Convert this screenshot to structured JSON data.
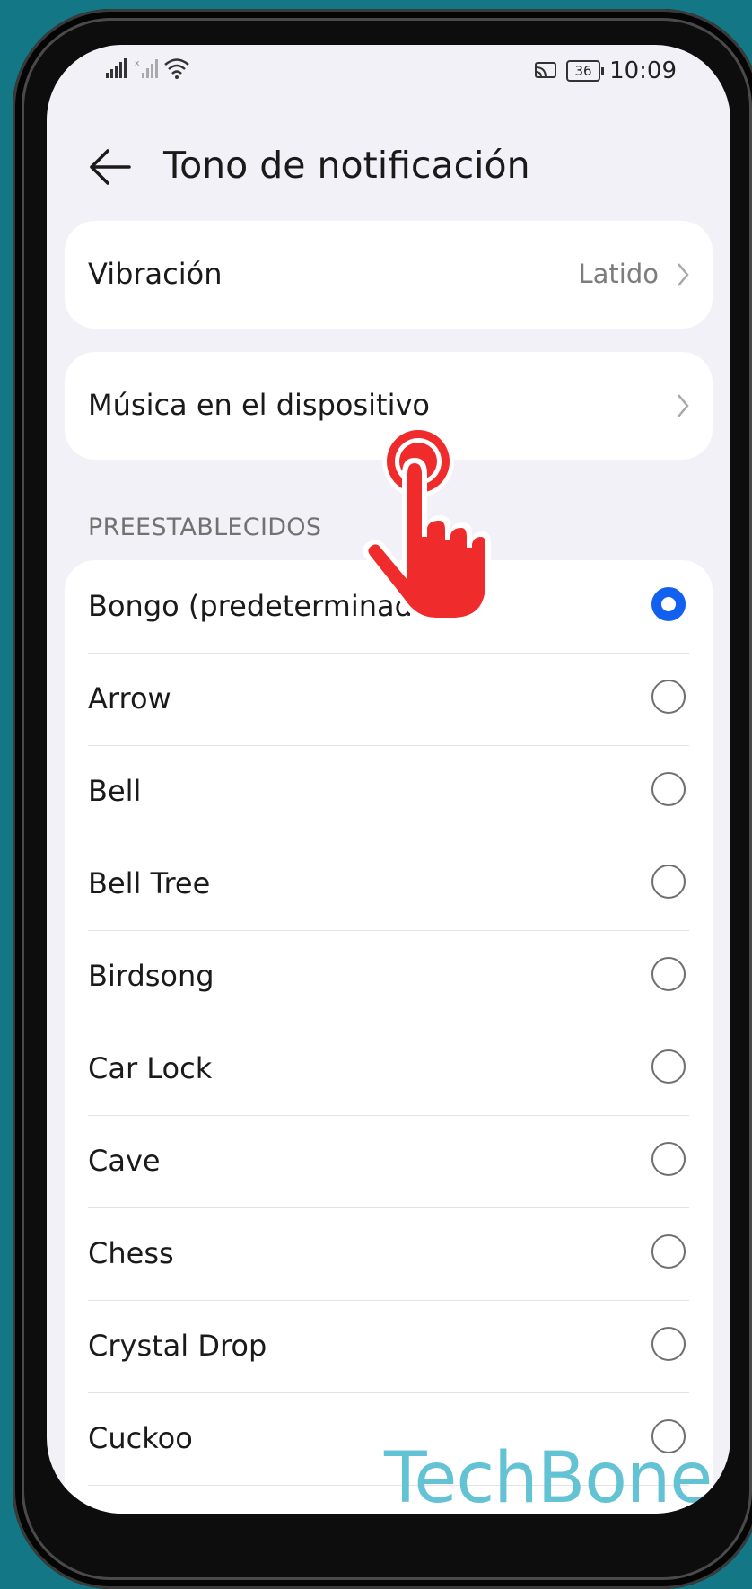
{
  "status_bar": {
    "time": "10:09",
    "battery": "36",
    "icons": [
      "signal-icon",
      "signal-no-sim-icon",
      "wifi-icon",
      "cast-icon",
      "battery-icon"
    ]
  },
  "header": {
    "back_icon": "arrow-left-icon",
    "title": "Tono de notificación"
  },
  "vibration": {
    "label": "Vibración",
    "value": "Latido"
  },
  "device_music": {
    "label": "Música en el dispositivo"
  },
  "presets": {
    "section_title": "PREESTABLECIDOS",
    "items": [
      {
        "label": "Bongo (predeterminado)",
        "selected": true
      },
      {
        "label": "Arrow",
        "selected": false
      },
      {
        "label": "Bell",
        "selected": false
      },
      {
        "label": "Bell Tree",
        "selected": false
      },
      {
        "label": "Birdsong",
        "selected": false
      },
      {
        "label": "Car Lock",
        "selected": false
      },
      {
        "label": "Cave",
        "selected": false
      },
      {
        "label": "Chess",
        "selected": false
      },
      {
        "label": "Crystal Drop",
        "selected": false
      },
      {
        "label": "Cuckoo",
        "selected": false
      }
    ]
  },
  "colors": {
    "background": "#137785",
    "accent": "#1160f0",
    "touch_indicator": "#f02b2b",
    "watermark": "#63c3d5"
  },
  "watermark": "TechBone"
}
